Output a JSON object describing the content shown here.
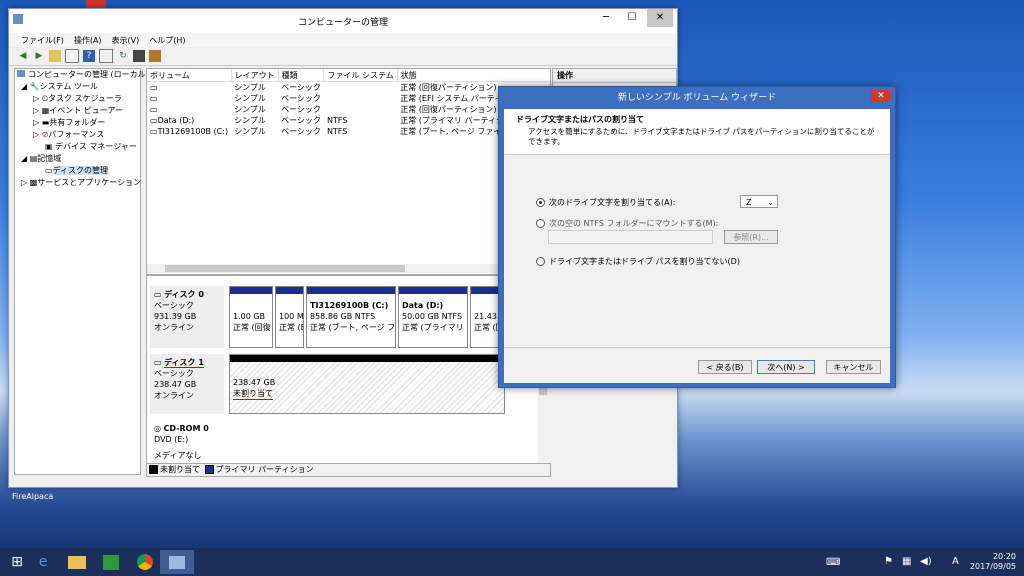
{
  "desktop": {
    "icon_label": "FireAlpaca"
  },
  "window": {
    "title": "コンピューターの管理",
    "min": "─",
    "max": "☐",
    "close": "✕",
    "menu": [
      "ファイル(F)",
      "操作(A)",
      "表示(V)",
      "ヘルプ(H)"
    ]
  },
  "tree": [
    "コンピューターの管理 (ローカル)",
    "システム ツール",
    "タスク スケジューラ",
    "イベント ビューアー",
    "共有フォルダー",
    "パフォーマンス",
    "デバイス マネージャー",
    "記憶域",
    "ディスクの管理",
    "サービスとアプリケーション"
  ],
  "volume_table": {
    "headers": [
      "ボリューム",
      "レイアウト",
      "種類",
      "ファイル システム",
      "状態"
    ],
    "rows": [
      [
        "",
        "シンプル",
        "ベーシック",
        "",
        "正常 (回復パーティション)"
      ],
      [
        "",
        "シンプル",
        "ベーシック",
        "",
        "正常 (EFI システム パーティション)"
      ],
      [
        "",
        "シンプル",
        "ベーシック",
        "",
        "正常 (回復パーティション)"
      ],
      [
        "Data (D:)",
        "シンプル",
        "ベーシック",
        "NTFS",
        "正常 (プライマリ パーティション)"
      ],
      [
        "TI31269100B (C:)",
        "シンプル",
        "ベーシック",
        "NTFS",
        "正常 (ブート, ページ ファイル, クラッシュ ダ"
      ]
    ]
  },
  "ops": {
    "header": "操作"
  },
  "disk0": {
    "name": "ディスク 0",
    "type": "ベーシック",
    "size": "931.39 GB",
    "status": "オンライン",
    "parts": [
      {
        "title": "",
        "size": "1.00 GB",
        "status": "正常 (回復"
      },
      {
        "title": "",
        "size": "100 M",
        "status": "正常 (E"
      },
      {
        "title": "TI31269100B (C:)",
        "size": "858.86 GB NTFS",
        "status": "正常 (ブート, ページ ファ"
      },
      {
        "title": "Data (D:)",
        "size": "50.00 GB NTFS",
        "status": "正常 (プライマリ パ"
      },
      {
        "title": "",
        "size": "21.43 GB",
        "status": "正常 (回"
      }
    ]
  },
  "disk1": {
    "name": "ディスク 1",
    "type": "ベーシック",
    "size": "238.47 GB",
    "status": "オンライン",
    "part_size": "238.47 GB",
    "part_status": "未割り当て"
  },
  "cdrom": {
    "name": "CD-ROM 0",
    "drive": "DVD (E:)",
    "media": "メディアなし"
  },
  "legend": {
    "unallocated": "未割り当て",
    "primary": "プライマリ パーティション"
  },
  "colors": {
    "primary": "#1c2f8c",
    "unallocated": "#000000",
    "wizard_frame": "#3c6fbf",
    "close_red": "#c93b2f"
  },
  "wizard": {
    "title": "新しいシンプル ボリューム ウィザード",
    "close": "✕",
    "heading": "ドライブ文字またはパスの割り当て",
    "desc": "アクセスを簡単にするために、ドライブ文字またはドライブ パスをパーティションに割り当てることができます。",
    "opt1": "次のドライブ文字を割り当てる(A):",
    "drive_letter": "Z",
    "opt2": "次の空の NTFS フォルダーにマウントする(M):",
    "browse": "参照(R)...",
    "opt3": "ドライブ文字またはドライブ パスを割り当てない(D)",
    "back": "< 戻る(B)",
    "next": "次へ(N) >",
    "cancel": "キャンセル"
  },
  "clock": {
    "time": "20:20",
    "date": "2017/09/05",
    "ime": "A"
  }
}
